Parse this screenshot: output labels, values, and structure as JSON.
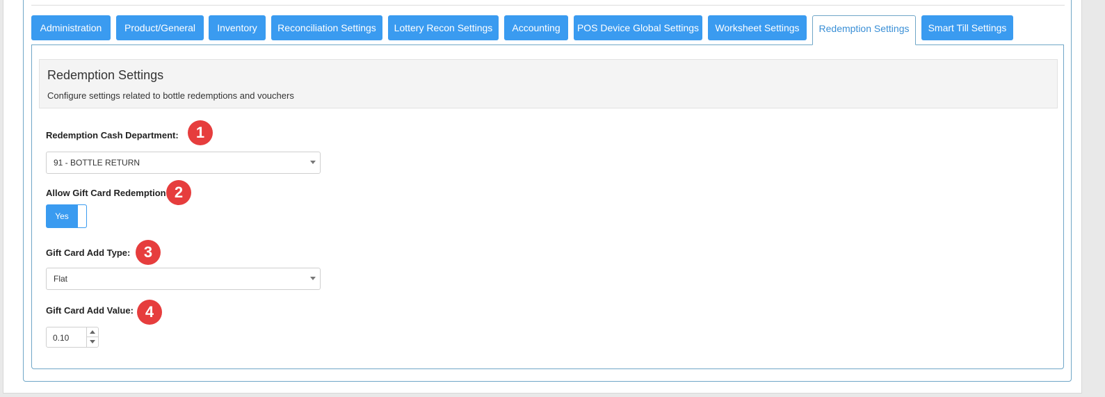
{
  "tabs": [
    {
      "label": "Administration",
      "active": false
    },
    {
      "label": "Product/General",
      "active": false
    },
    {
      "label": "Inventory",
      "active": false
    },
    {
      "label": "Reconciliation Settings",
      "active": false
    },
    {
      "label": "Lottery Recon Settings",
      "active": false
    },
    {
      "label": "Accounting",
      "active": false
    },
    {
      "label": "POS Device Global Settings",
      "active": false
    },
    {
      "label": "Worksheet Settings",
      "active": false
    },
    {
      "label": "Redemption Settings",
      "active": true
    },
    {
      "label": "Smart Till Settings",
      "active": false
    }
  ],
  "header": {
    "title": "Redemption Settings",
    "subtitle": "Configure settings related to bottle redemptions and vouchers"
  },
  "fields": {
    "cash_department": {
      "label": "Redemption Cash Department:",
      "value": "91 - BOTTLE RETURN",
      "badge": "1"
    },
    "gift_card_redemption": {
      "label": "Allow Gift Card Redemption:",
      "toggle_label": "Yes",
      "badge": "2"
    },
    "gift_card_add_type": {
      "label": "Gift Card Add Type:",
      "value": "Flat",
      "badge": "3"
    },
    "gift_card_add_value": {
      "label": "Gift Card Add Value:",
      "value": "0.10",
      "badge": "4"
    }
  },
  "colors": {
    "accent": "#3a9bf0",
    "badge": "#e63d3d",
    "frame_border": "#6fa6c7"
  },
  "icons": {
    "select_caret": "chevron-down-icon",
    "stepper_up": "caret-up-icon",
    "stepper_down": "caret-down-icon"
  }
}
